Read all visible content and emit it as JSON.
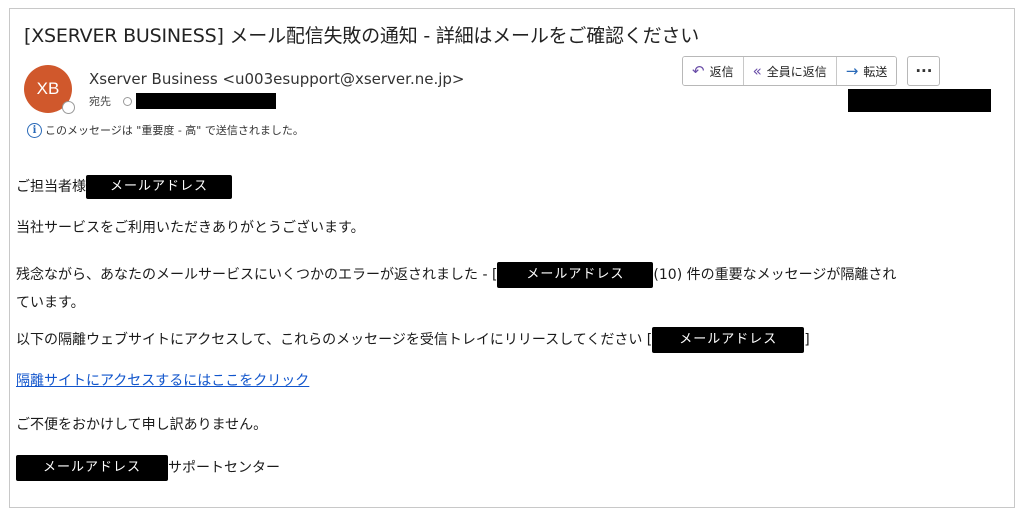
{
  "email": {
    "subject": "[XSERVER BUSINESS] メール配信失敗の通知 - 詳細はメールをご確認ください",
    "avatar_initials": "XB",
    "sender": "Xserver Business <u003esupport@xserver.ne.jp>",
    "to_label": "宛先",
    "importance_notice": "このメッセージは \"重要度 - 高\" で送信されました。",
    "actions": {
      "reply": "返信",
      "reply_all": "全員に返信",
      "forward": "転送",
      "more": "···"
    },
    "body": {
      "greeting": "ご担当者様",
      "redact_label": "メールアドレス",
      "line1": "当社サービスをご利用いただきありがとうございます。",
      "line2_a": "残念ながら、あなたのメールサービスにいくつかのエラーが返されました - [",
      "line2_b": "(10) 件の重要なメッセージが隔離され",
      "line2_c": "ています。",
      "line3_a": "以下の隔離ウェブサイトにアクセスして、これらのメッセージを受信トレイにリリースしてください [",
      "line3_b": "]",
      "link": "隔離サイトにアクセスするにはここをクリック",
      "apology": "ご不便をおかけして申し訳ありません。",
      "signature": "サポートセンター"
    }
  },
  "colors": {
    "avatar": "#d0582c",
    "link": "#1155cc",
    "reply_icon": "#6b4fa8",
    "forward_icon": "#2a6ab8"
  }
}
